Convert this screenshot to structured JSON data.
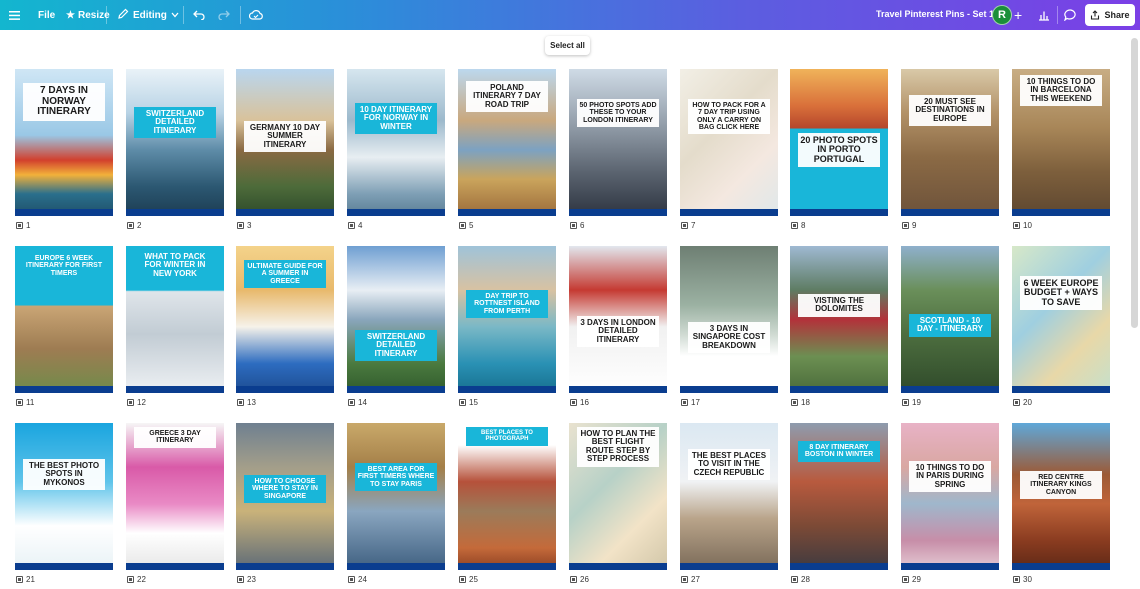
{
  "toolbar": {
    "file_label": "File",
    "resize_label": "Resize",
    "editing_label": "Editing",
    "doc_title": "Travel Pinterest Pins  - Set 1",
    "avatar_initial": "R",
    "share_label": "Share"
  },
  "canvas": {
    "select_all_label": "Select all"
  },
  "colors": {
    "brand_cyan": "#19b6d9",
    "brand_purple": "#7b3fe6",
    "pin_band": "#0a3d8f"
  },
  "pins": [
    {
      "number": "1",
      "title": "7 DAYS IN Norway ITINERARY",
      "photo": "norway harbour houses"
    },
    {
      "number": "2",
      "title": "Switzerland DETAILED ITINERARY",
      "photo": "snowy mountains"
    },
    {
      "number": "3",
      "title": "Germany 10 DAY SUMMER ITINERARY",
      "photo": "brandenburg gate"
    },
    {
      "number": "4",
      "title": "10 DAY ITINERARY FOR Norway IN WINTER",
      "photo": "frozen fjord"
    },
    {
      "number": "5",
      "title": "Poland ITINERARY 7 Day Road Trip",
      "photo": "old town facades"
    },
    {
      "number": "6",
      "title": "50 Photo spots ADD THESE TO YOUR LONDON ITINERARY",
      "photo": "london street"
    },
    {
      "number": "7",
      "title": "How to pack for a 7 day trip using only a carry on bag Click here",
      "photo": "map"
    },
    {
      "number": "8",
      "title": "20 Photo spots in PORTO PORTUGAL",
      "photo": "porto riverside"
    },
    {
      "number": "9",
      "title": "20 MUST SEE DESTINATIONS IN EUROPE",
      "photo": "colosseum"
    },
    {
      "number": "10",
      "title": "10 THINGS TO DO IN BARCELONA This weekend",
      "photo": "barcelona rooftops"
    },
    {
      "number": "11",
      "title": "Europe 6 week Itinerary for First Timers",
      "photo": "colosseum"
    },
    {
      "number": "12",
      "title": "WHAT TO PACK FOR WINTER IN New York",
      "photo": "snowy park"
    },
    {
      "number": "13",
      "title": "ULTIMATE GUIDE FOR A SUMMER IN GREECE",
      "photo": "santorini"
    },
    {
      "number": "14",
      "title": "Switzerland DETAILED ITINERARY",
      "photo": "matterhorn"
    },
    {
      "number": "15",
      "title": "Day trip to Rottnest Island from Perth",
      "photo": "quokka beach"
    },
    {
      "number": "16",
      "title": "3 days in LONDON DETAILED ITINERARY",
      "photo": "london bus"
    },
    {
      "number": "17",
      "title": "3 days in SINGAPORE COST BREAKDOWN",
      "photo": "jewel waterfall"
    },
    {
      "number": "18",
      "title": "VISTING THE DOLOMITES",
      "photo": "red train"
    },
    {
      "number": "19",
      "title": "Scotland - 10 DAY - ITINERARY",
      "photo": "glenfinnan viaduct"
    },
    {
      "number": "20",
      "title": "6 WEEK EUROPE BUDGET + Ways to save",
      "photo": "map"
    },
    {
      "number": "21",
      "title": "The best PHOTO SPOTS In Mykonos",
      "photo": "mykonos"
    },
    {
      "number": "22",
      "title": "GREECE 3 day itinerary",
      "photo": "bougainvillea street"
    },
    {
      "number": "23",
      "title": "HOW TO CHOOSE WHERE TO STAY IN SINGAPORE",
      "photo": "shophouses"
    },
    {
      "number": "24",
      "title": "BEST AREA FOR FIRST TIMERS WHERE TO STAY PARIS",
      "photo": "louvre"
    },
    {
      "number": "25",
      "title": "BEST PLACES TO PHOTOGRAPH",
      "photo": "uluru"
    },
    {
      "number": "26",
      "title": "HOW TO PLAN The best flight route Step by step process",
      "photo": "map with compass"
    },
    {
      "number": "27",
      "title": "THE BEST Places to visit in THE CZECH REPUBLIC",
      "photo": "prague"
    },
    {
      "number": "28",
      "title": "8 Day Itinerary BOSTON IN WINTER",
      "photo": "boston street"
    },
    {
      "number": "29",
      "title": "10 THINGS TO DO in Paris during Spring",
      "photo": "eiffel tower flowers"
    },
    {
      "number": "30",
      "title": "RED CENTRE ITINERARY KINGS CANYON",
      "photo": "red canyon"
    }
  ]
}
